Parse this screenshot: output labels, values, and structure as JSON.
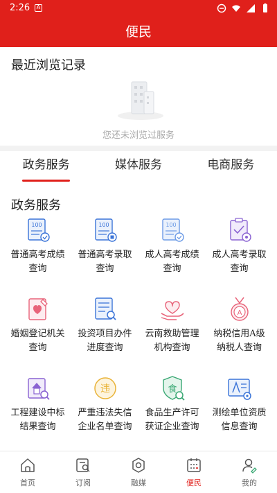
{
  "status_bar": {
    "time": "2:26"
  },
  "header": {
    "title": "便民"
  },
  "recent": {
    "title": "最近浏览记录",
    "empty_text": "您还未浏览过服务"
  },
  "tabs": [
    {
      "label": "政务服务",
      "active": true
    },
    {
      "label": "媒体服务",
      "active": false
    },
    {
      "label": "电商服务",
      "active": false
    }
  ],
  "services": {
    "title": "政务服务",
    "items": [
      {
        "label": "普通高考成绩查询",
        "icon": "exam-score-icon"
      },
      {
        "label": "普通高考录取查询",
        "icon": "admission-icon"
      },
      {
        "label": "成人高考成绩查询",
        "icon": "adult-exam-score-icon"
      },
      {
        "label": "成人高考录取查询",
        "icon": "adult-admission-icon"
      },
      {
        "label": "婚姻登记机关查询",
        "icon": "marriage-icon"
      },
      {
        "label": "投资项目办件进度查询",
        "icon": "investment-icon"
      },
      {
        "label": "云南救助管理机构查询",
        "icon": "relief-icon"
      },
      {
        "label": "纳税信用A级纳税人查询",
        "icon": "tax-credit-icon"
      },
      {
        "label": "工程建设中标结果查询",
        "icon": "construction-bid-icon"
      },
      {
        "label": "严重违法失信企业名单查询",
        "icon": "violation-icon"
      },
      {
        "label": "食品生产许可获证企业查询",
        "icon": "food-license-icon"
      },
      {
        "label": "测绘单位资质信息查询",
        "icon": "survey-icon"
      }
    ]
  },
  "bottom_nav": [
    {
      "label": "首页",
      "icon": "home-icon",
      "active": false
    },
    {
      "label": "订阅",
      "icon": "subscribe-icon",
      "active": false
    },
    {
      "label": "融媒",
      "icon": "media-icon",
      "active": false
    },
    {
      "label": "便民",
      "icon": "convenience-icon",
      "active": true
    },
    {
      "label": "我的",
      "icon": "profile-icon",
      "active": false
    }
  ],
  "colors": {
    "brand_red": "#e0201b",
    "icon_blue": "#3b74d8",
    "icon_purple": "#8a63d2",
    "icon_pink": "#e8647a",
    "icon_yellow": "#e9b338",
    "icon_green": "#3aa874"
  }
}
